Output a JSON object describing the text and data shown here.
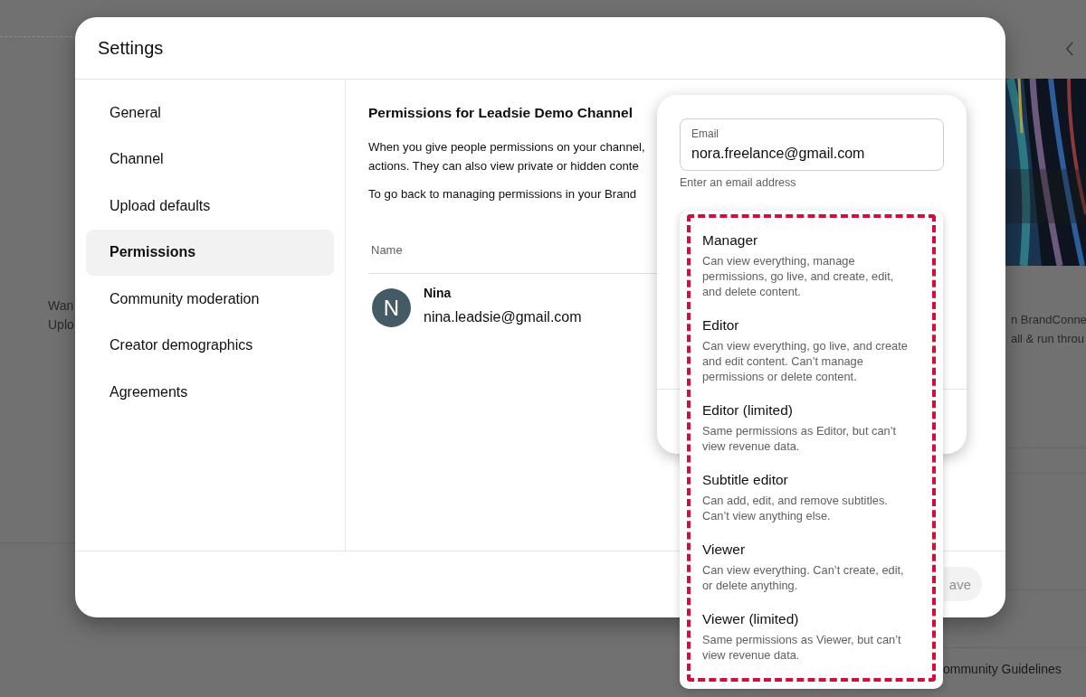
{
  "background": {
    "left_texts": [
      "Wan",
      "Uplo"
    ],
    "right_texts": [
      "n BrandConne",
      "all & run throu"
    ],
    "bottom_text": "ommunity Guidelines"
  },
  "dialog": {
    "title": "Settings",
    "sidebar": {
      "items": [
        {
          "label": "General",
          "selected": false
        },
        {
          "label": "Channel",
          "selected": false
        },
        {
          "label": "Upload defaults",
          "selected": false
        },
        {
          "label": "Permissions",
          "selected": true
        },
        {
          "label": "Community moderation",
          "selected": false
        },
        {
          "label": "Creator demographics",
          "selected": false
        },
        {
          "label": "Agreements",
          "selected": false
        }
      ]
    },
    "content": {
      "heading": "Permissions for Leadsie Demo Channel",
      "paragraphs": [
        "When you give people permissions on your channel,",
        "actions. They can also view private or hidden conte",
        "To go back to managing permissions in your Brand"
      ],
      "table": {
        "columns": [
          "Name"
        ],
        "rows": [
          {
            "avatar": "N",
            "name": "Nina",
            "email": "nina.leadsie@gmail.com"
          }
        ]
      }
    },
    "footer": {
      "save_button": "ave"
    }
  },
  "invite_popup": {
    "email_field": {
      "label": "Email",
      "value": "nora.freelance@gmail.com",
      "helper": "Enter an email address"
    },
    "roles": [
      {
        "title": "Manager",
        "description": "Can view everything, manage permissions, go live, and create, edit, and delete content."
      },
      {
        "title": "Editor",
        "description": "Can view everything, go live, and create and edit content. Can’t manage permissions or delete content."
      },
      {
        "title": "Editor (limited)",
        "description": "Same permissions as Editor, but can’t view revenue data."
      },
      {
        "title": "Subtitle editor",
        "description": "Can add, edit, and remove subtitles. Can’t view anything else."
      },
      {
        "title": "Viewer",
        "description": "Can view everything. Can’t create, edit, or delete anything."
      },
      {
        "title": "Viewer (limited)",
        "description": "Same permissions as Viewer, but can’t view revenue data."
      }
    ]
  }
}
